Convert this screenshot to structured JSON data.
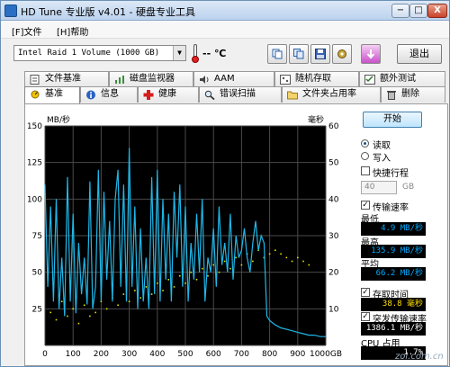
{
  "window": {
    "title": "HD Tune 专业版 v4.01 - 硬盘专业工具",
    "min_label": "−",
    "max_label": "□",
    "close_label": "X"
  },
  "menu": {
    "file": "[F]文件",
    "help": "[H]帮助"
  },
  "toolbar": {
    "drive": "Intel   Raid 1 Volume (1000 GB)",
    "temperature": "-- ℃",
    "exit_label": "退出"
  },
  "tabs_row1": [
    "文件基准",
    "磁盘监视器",
    "AAM",
    "随机存取",
    "额外测试"
  ],
  "tabs_row2": [
    "基准",
    "信息",
    "健康",
    "错误扫描",
    "文件夹占用率",
    "删除"
  ],
  "colors": {
    "transfer_line": "#1fb7e8",
    "access_dots": "#e8e000",
    "plot_bg": "#000000",
    "grid": "#4a4a4a"
  },
  "side": {
    "start_label": "开始",
    "read_label": "读取",
    "write_label": "写入",
    "short_stroke_label": "快捷行程",
    "short_stroke_value": "40",
    "short_stroke_unit": "GB",
    "transfer_rate_label": "传输速率",
    "min_label": "最低",
    "min_value": "4.9 MB/秒",
    "max_label": "最高",
    "max_value": "135.9 MB/秒",
    "avg_label": "平均",
    "avg_value": "66.2 MB/秒",
    "access_time_label": "存取时间",
    "access_time_value": "38.8 毫秒",
    "burst_label": "突发传输速率",
    "burst_value": "1386.1 MB/秒",
    "cpu_label": "CPU 占用",
    "cpu_value": "1.7%"
  },
  "watermark": "zol.com.cn",
  "chart_data": {
    "type": "line",
    "left_axis_label": "MB/秒",
    "right_axis_label": "毫秒",
    "x_ticks": [
      "0",
      "100",
      "200",
      "300",
      "400",
      "500",
      "600",
      "700",
      "800",
      "900",
      "1000GB"
    ],
    "left_ticks": [
      "150",
      "125",
      "100",
      "75",
      "50",
      "25"
    ],
    "right_ticks": [
      "60",
      "50",
      "40",
      "30",
      "20",
      "10"
    ],
    "xlim": [
      0,
      1000
    ],
    "ylim_left": [
      0,
      150
    ],
    "ylim_right": [
      0,
      60
    ],
    "grid": true,
    "series": [
      {
        "x": [
          0,
          10,
          20,
          30,
          40,
          50,
          60,
          70,
          80,
          90,
          100,
          110,
          120,
          130,
          140,
          150,
          160,
          170,
          180,
          190,
          200,
          210,
          220,
          230,
          240,
          250,
          260,
          270,
          280,
          290,
          300,
          310,
          320,
          330,
          340,
          350,
          360,
          370,
          380,
          390,
          400,
          410,
          420,
          430,
          440,
          450,
          460,
          470,
          480,
          490,
          500,
          510,
          520,
          530,
          540,
          550,
          560,
          570,
          580,
          590,
          600,
          610,
          620,
          630,
          640,
          650,
          660,
          670,
          680,
          690,
          700,
          710,
          720,
          730,
          740,
          750,
          760,
          770,
          780,
          790,
          800,
          820,
          840,
          860,
          880,
          900,
          920,
          940,
          960,
          980,
          1000
        ],
        "y": [
          110,
          40,
          95,
          30,
          100,
          25,
          60,
          20,
          115,
          30,
          90,
          22,
          70,
          35,
          60,
          28,
          112,
          25,
          40,
          120,
          30,
          105,
          45,
          85,
          30,
          100,
          120,
          40,
          110,
          30,
          135,
          40,
          95,
          25,
          80,
          30,
          60,
          25,
          115,
          35,
          120,
          30,
          100,
          45,
          90,
          30,
          105,
          60,
          110,
          40,
          95,
          30,
          70,
          45,
          90,
          50,
          100,
          30,
          60,
          50,
          80,
          40,
          95,
          55,
          70,
          50,
          90,
          45,
          75,
          60,
          65,
          80,
          60,
          50,
          70,
          85,
          65,
          75,
          70,
          20,
          17,
          14,
          12,
          11,
          10,
          9,
          8,
          7,
          7,
          6,
          6
        ]
      }
    ],
    "access_points_ms": [
      [
        20,
        9
      ],
      [
        40,
        7
      ],
      [
        60,
        12
      ],
      [
        80,
        8
      ],
      [
        100,
        10
      ],
      [
        120,
        6
      ],
      [
        140,
        11
      ],
      [
        160,
        8
      ],
      [
        180,
        9
      ],
      [
        200,
        12
      ],
      [
        220,
        10
      ],
      [
        240,
        13
      ],
      [
        260,
        11
      ],
      [
        280,
        14
      ],
      [
        300,
        12
      ],
      [
        320,
        15
      ],
      [
        340,
        13
      ],
      [
        360,
        16
      ],
      [
        380,
        14
      ],
      [
        400,
        17
      ],
      [
        420,
        15
      ],
      [
        440,
        18
      ],
      [
        460,
        16
      ],
      [
        480,
        19
      ],
      [
        500,
        17
      ],
      [
        520,
        20
      ],
      [
        540,
        18
      ],
      [
        560,
        21
      ],
      [
        580,
        19
      ],
      [
        600,
        22
      ],
      [
        620,
        20
      ],
      [
        640,
        23
      ],
      [
        660,
        21
      ],
      [
        680,
        24
      ],
      [
        700,
        22
      ],
      [
        720,
        25
      ],
      [
        740,
        23
      ],
      [
        760,
        26
      ],
      [
        780,
        24
      ],
      [
        800,
        25
      ],
      [
        820,
        26
      ],
      [
        840,
        25
      ],
      [
        860,
        24
      ],
      [
        880,
        23
      ],
      [
        900,
        24
      ],
      [
        920,
        23
      ],
      [
        940,
        22
      ]
    ]
  }
}
